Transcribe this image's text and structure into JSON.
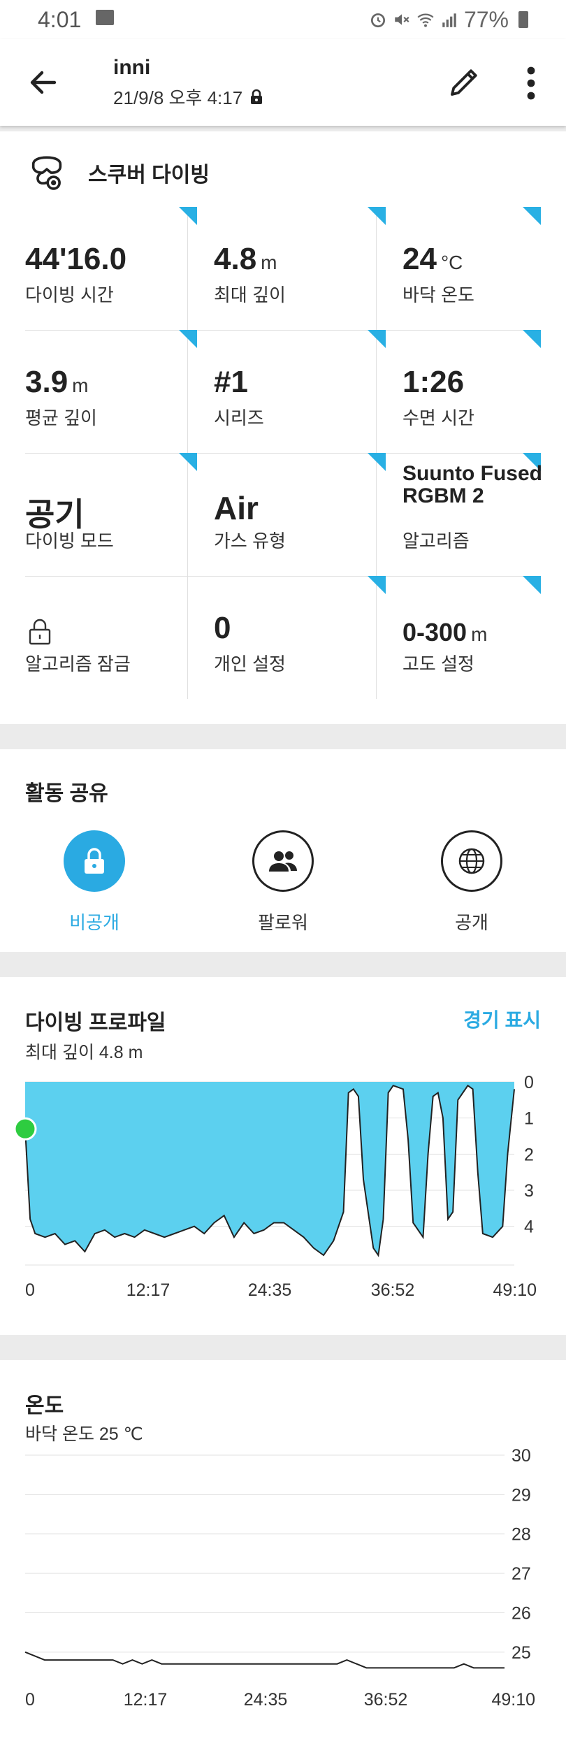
{
  "status": {
    "time": "4:01",
    "battery": "77%"
  },
  "header": {
    "user": "inni",
    "datetime": "21/9/8 오후 4:17"
  },
  "sport": "스쿠버 다이빙",
  "stats": [
    {
      "value": "44'16.0",
      "unit": "",
      "label": "다이빙 시간"
    },
    {
      "value": "4.8",
      "unit": "m",
      "label": "최대 깊이"
    },
    {
      "value": "24",
      "unit": "°C",
      "label": "바닥 온도"
    },
    {
      "value": "3.9",
      "unit": "m",
      "label": "평균 깊이"
    },
    {
      "value": "#1",
      "unit": "",
      "label": "시리즈"
    },
    {
      "value": "1:26",
      "unit": "",
      "label": "수면 시간"
    },
    {
      "value": "공기",
      "unit": "",
      "label": "다이빙 모드"
    },
    {
      "value": "Air",
      "unit": "",
      "label": "가스 유형"
    },
    {
      "value": "Suunto Fused RGBM 2",
      "unit": "",
      "label": "알고리즘"
    },
    {
      "value": "",
      "unit": "",
      "label": "알고리즘 잠금"
    },
    {
      "value": "0",
      "unit": "",
      "label": "개인 설정"
    },
    {
      "value": "0-300",
      "unit": "m",
      "label": "고도 설정"
    }
  ],
  "share": {
    "title": "활동 공유",
    "options": [
      {
        "label": "비공개",
        "icon": "lock-icon",
        "selected": true
      },
      {
        "label": "팔로워",
        "icon": "followers-icon",
        "selected": false
      },
      {
        "label": "공개",
        "icon": "globe-icon",
        "selected": false
      }
    ]
  },
  "profile": {
    "title": "다이빙 프로파일",
    "subtitle": "최대 깊이 4.8 m",
    "link": "경기 표시"
  },
  "temperature": {
    "title": "온도",
    "subtitle": "바닥 온도 25 ℃"
  },
  "colors": {
    "accent": "#2aaae2",
    "corner": "#29b0e4",
    "depth_fill": "#5cd0ef",
    "start_dot": "#2ecc40"
  },
  "chart_data": [
    {
      "type": "area",
      "title": "다이빙 프로파일",
      "x_tick_labels": [
        "0",
        "12:17",
        "24:35",
        "36:52",
        "49:10"
      ],
      "y_tick_labels": [
        "0",
        "1",
        "2",
        "3",
        "4"
      ],
      "x_unit": "min:sec",
      "y_unit": "m (depth)",
      "ylim": [
        0,
        4.8
      ],
      "y_inverted": true,
      "x": [
        0,
        0.5,
        1,
        2,
        3,
        4,
        5,
        6,
        7,
        8,
        9,
        10,
        11,
        12,
        13,
        14,
        15,
        16,
        17,
        18,
        19,
        20,
        21,
        22,
        23,
        24,
        25,
        26,
        27,
        28,
        29,
        30,
        31,
        32,
        32.5,
        33,
        33.5,
        34,
        35,
        35.5,
        36,
        36.5,
        37,
        38,
        38.5,
        39,
        40,
        40.5,
        41,
        41.5,
        42,
        42.5,
        43,
        43.5,
        44,
        44.5,
        45,
        45.5,
        46,
        47,
        48,
        48.5,
        49.17
      ],
      "values": [
        1.3,
        3.8,
        4.2,
        4.3,
        4.2,
        4.5,
        4.4,
        4.7,
        4.2,
        4.1,
        4.3,
        4.2,
        4.3,
        4.1,
        4.2,
        4.3,
        4.2,
        4.1,
        4.0,
        4.2,
        3.9,
        3.7,
        4.3,
        3.9,
        4.2,
        4.1,
        3.9,
        3.9,
        4.1,
        4.3,
        4.6,
        4.8,
        4.4,
        3.6,
        0.3,
        0.2,
        0.4,
        2.7,
        4.6,
        4.8,
        3.8,
        0.3,
        0.1,
        0.2,
        1.6,
        3.9,
        4.3,
        2.0,
        0.4,
        0.3,
        1.0,
        3.8,
        3.6,
        0.5,
        0.3,
        0.1,
        0.2,
        2.5,
        4.2,
        4.3,
        4.0,
        2.0,
        0.2
      ]
    },
    {
      "type": "line",
      "title": "온도",
      "x_tick_labels": [
        "0",
        "12:17",
        "24:35",
        "36:52",
        "49:10"
      ],
      "y_tick_labels": [
        "30",
        "29",
        "28",
        "27",
        "26",
        "25"
      ],
      "x_unit": "min:sec",
      "y_unit": "°C",
      "ylim": [
        24.5,
        30
      ],
      "x": [
        0,
        1,
        2,
        3,
        4,
        5,
        6,
        7,
        8,
        9,
        10,
        11,
        12,
        13,
        14,
        15,
        16,
        17,
        18,
        19,
        20,
        21,
        22,
        23,
        24,
        25,
        26,
        27,
        28,
        29,
        30,
        31,
        32,
        33,
        34,
        35,
        36,
        37,
        38,
        39,
        40,
        41,
        42,
        43,
        44,
        45,
        46,
        47,
        48,
        49.17
      ],
      "values": [
        25.0,
        24.9,
        24.8,
        24.8,
        24.8,
        24.8,
        24.8,
        24.8,
        24.8,
        24.8,
        24.7,
        24.8,
        24.7,
        24.8,
        24.7,
        24.7,
        24.7,
        24.7,
        24.7,
        24.7,
        24.7,
        24.7,
        24.7,
        24.7,
        24.7,
        24.7,
        24.7,
        24.7,
        24.7,
        24.7,
        24.7,
        24.7,
        24.7,
        24.8,
        24.7,
        24.6,
        24.6,
        24.6,
        24.6,
        24.6,
        24.6,
        24.6,
        24.6,
        24.6,
        24.6,
        24.7,
        24.6,
        24.6,
        24.6,
        24.6
      ]
    }
  ]
}
